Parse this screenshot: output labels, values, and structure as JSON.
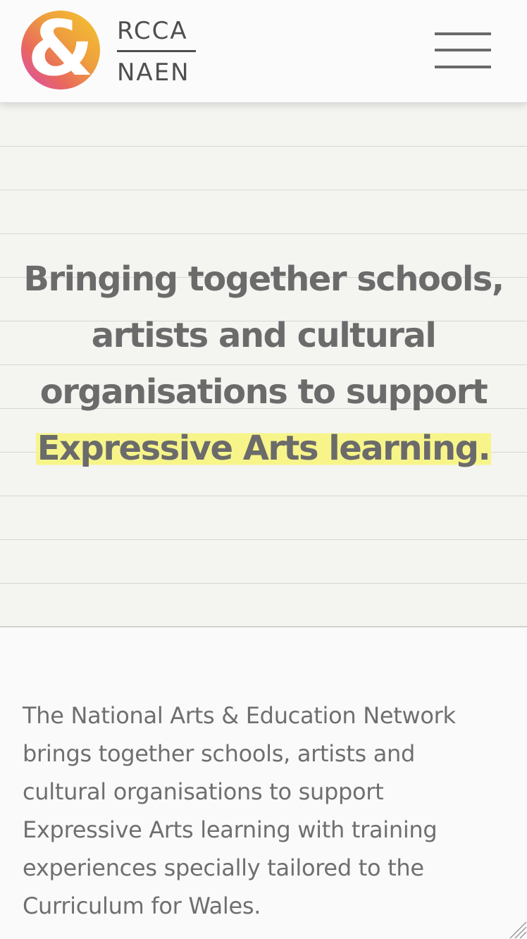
{
  "header": {
    "logo_symbol": "&",
    "logo_top": "RCCA",
    "logo_bottom": "NAEN",
    "menu_icon": "hamburger-menu-icon"
  },
  "hero": {
    "line1": "Bringing together schools,",
    "line2": "artists and cultural",
    "line3": "organisations to support",
    "highlight": "Expressive Arts learning."
  },
  "intro": {
    "line1": "The National Arts & Education Network",
    "line2": "brings together schools, artists and",
    "line3": "cultural organisations to support",
    "line4": "Expressive Arts learning with training",
    "line5": "experiences specially tailored to the",
    "line6": "Curriculum for Wales."
  },
  "colors": {
    "logo_gradient_start": "#f4c52f",
    "logo_gradient_end": "#d84fb6",
    "highlight": "#f7f58a",
    "text": "#6b6b6b",
    "hero_background": "#f4f4f1"
  }
}
